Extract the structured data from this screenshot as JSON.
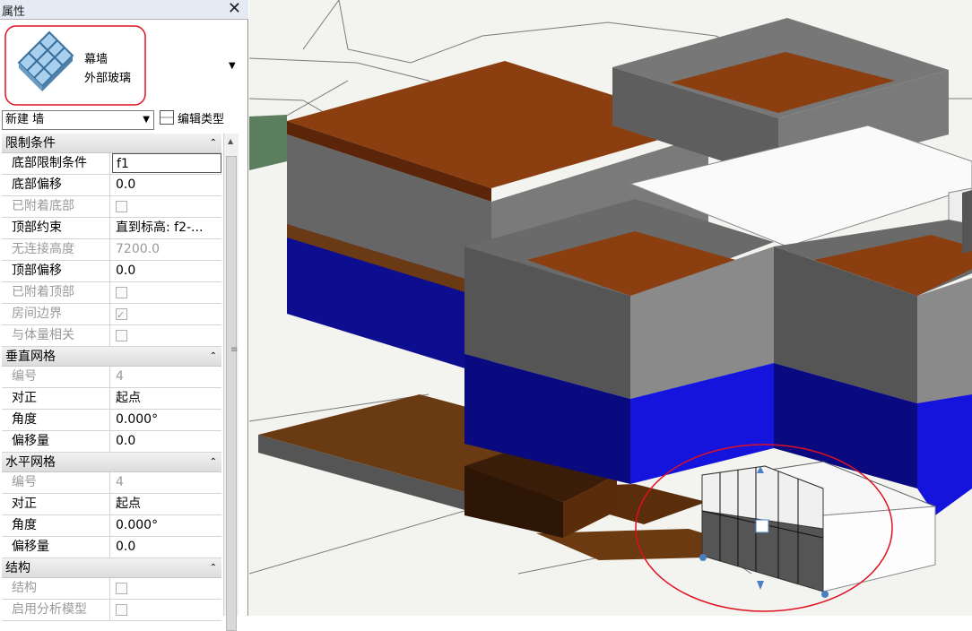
{
  "panel": {
    "title": "属性",
    "close_glyph": "✕",
    "type": {
      "family": "幕墙",
      "name": "外部玻璃",
      "icon": "curtain-wall-thumbnail"
    },
    "instance_filter": "新建 墙",
    "edit_type_label": "编辑类型"
  },
  "groups": [
    {
      "label": "限制条件",
      "rows": [
        {
          "key": "底部限制条件",
          "value": "f1",
          "disabled": false,
          "editing": true
        },
        {
          "key": "底部偏移",
          "value": "0.0",
          "disabled": false
        },
        {
          "key": "已附着底部",
          "checkbox": false,
          "disabled": true
        },
        {
          "key": "顶部约束",
          "value": "直到标高: f2-...",
          "disabled": false
        },
        {
          "key": "无连接高度",
          "value": "7200.0",
          "disabled": true
        },
        {
          "key": "顶部偏移",
          "value": "0.0",
          "disabled": false
        },
        {
          "key": "已附着顶部",
          "checkbox": false,
          "disabled": true
        },
        {
          "key": "房间边界",
          "checkbox": true,
          "disabled": true
        },
        {
          "key": "与体量相关",
          "checkbox": false,
          "disabled": true
        }
      ]
    },
    {
      "label": "垂直网格",
      "rows": [
        {
          "key": "编号",
          "value": "4",
          "disabled": true
        },
        {
          "key": "对正",
          "value": "起点",
          "disabled": false
        },
        {
          "key": "角度",
          "value": "0.000°",
          "disabled": false
        },
        {
          "key": "偏移量",
          "value": "0.0",
          "disabled": false
        }
      ]
    },
    {
      "label": "水平网格",
      "rows": [
        {
          "key": "编号",
          "value": "4",
          "disabled": true
        },
        {
          "key": "对正",
          "value": "起点",
          "disabled": false
        },
        {
          "key": "角度",
          "value": "0.000°",
          "disabled": false
        },
        {
          "key": "偏移量",
          "value": "0.0",
          "disabled": false
        }
      ]
    },
    {
      "label": "结构",
      "rows": [
        {
          "key": "结构",
          "checkbox": false,
          "disabled": true
        },
        {
          "key": "启用分析模型",
          "checkbox": false,
          "disabled": true
        }
      ]
    }
  ],
  "colors": {
    "annotation_red": "#e01020",
    "roof_brown": "#8b3a0c",
    "panel_gray": "#6b6b6b",
    "glass_blue": "#1010d8",
    "selection_blue": "#4a7fc0"
  }
}
